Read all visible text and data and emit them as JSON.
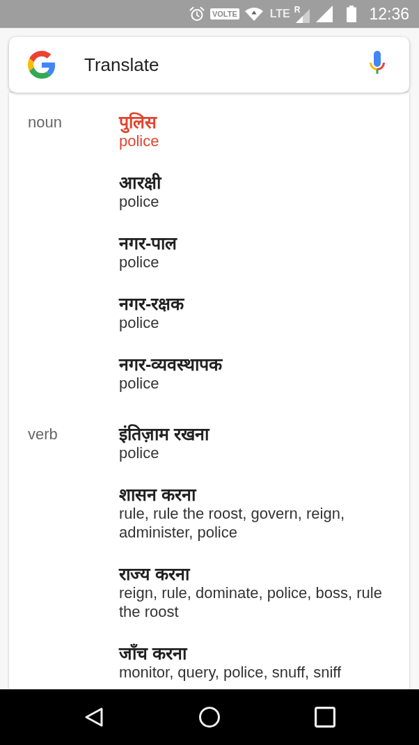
{
  "status_bar": {
    "volte": "VOLTE",
    "network": "LTE",
    "roaming": "R",
    "time": "12:36"
  },
  "search": {
    "value": "Translate"
  },
  "sections": [
    {
      "part_of_speech": "noun",
      "entries": [
        {
          "word": "पुलिस",
          "meaning": "police",
          "highlighted": true
        },
        {
          "word": "आरक्षी",
          "meaning": "police",
          "highlighted": false
        },
        {
          "word": "नगर-पाल",
          "meaning": "police",
          "highlighted": false
        },
        {
          "word": "नगर-रक्षक",
          "meaning": "police",
          "highlighted": false
        },
        {
          "word": "नगर-व्यवस्थापक",
          "meaning": "police",
          "highlighted": false
        }
      ]
    },
    {
      "part_of_speech": "verb",
      "entries": [
        {
          "word": "इंतिज़ाम रखना",
          "meaning": "police",
          "highlighted": false
        },
        {
          "word": "शासन करना",
          "meaning": "rule, rule the roost, govern, reign, administer, police",
          "highlighted": false
        },
        {
          "word": "राज्य करना",
          "meaning": "reign, rule, dominate, police, boss, rule the roost",
          "highlighted": false
        },
        {
          "word": "जाँच करना",
          "meaning": "monitor, query, police, snuff, sniff",
          "highlighted": false
        }
      ]
    }
  ]
}
